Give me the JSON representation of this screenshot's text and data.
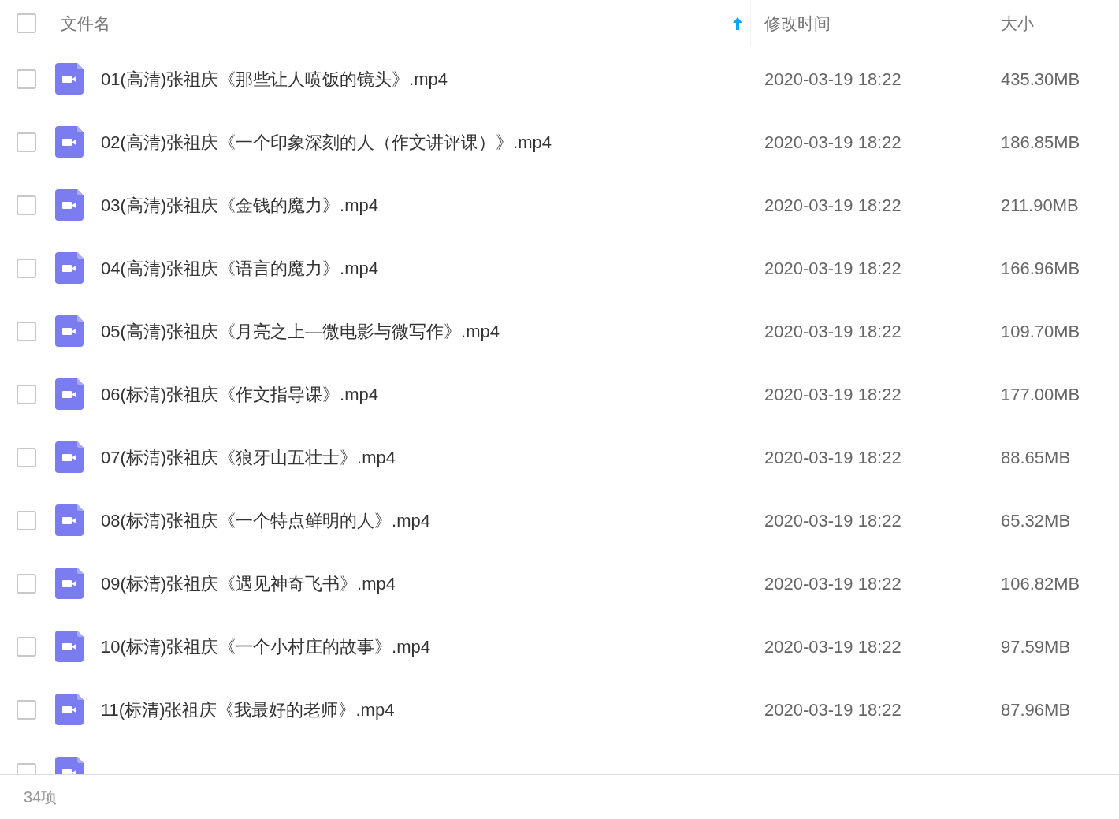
{
  "header": {
    "checked": false,
    "columns": [
      {
        "label": "文件名",
        "sorted": true
      },
      {
        "label": "修改时间",
        "sorted": false
      },
      {
        "label": "大小",
        "sorted": false
      }
    ]
  },
  "files": [
    {
      "checked": false,
      "name": "01(高清)张祖庆《那些让人喷饭的镜头》.mp4",
      "modified": "2020-03-19 18:22",
      "size": "435.30MB"
    },
    {
      "checked": false,
      "name": "02(高清)张祖庆《一个印象深刻的人（作文讲评课）》.mp4",
      "modified": "2020-03-19 18:22",
      "size": "186.85MB"
    },
    {
      "checked": false,
      "name": "03(高清)张祖庆《金钱的魔力》.mp4",
      "modified": "2020-03-19 18:22",
      "size": "211.90MB"
    },
    {
      "checked": false,
      "name": "04(高清)张祖庆《语言的魔力》.mp4",
      "modified": "2020-03-19 18:22",
      "size": "166.96MB"
    },
    {
      "checked": false,
      "name": "05(高清)张祖庆《月亮之上—微电影与微写作》.mp4",
      "modified": "2020-03-19 18:22",
      "size": "109.70MB"
    },
    {
      "checked": false,
      "name": "06(标清)张祖庆《作文指导课》.mp4",
      "modified": "2020-03-19 18:22",
      "size": "177.00MB"
    },
    {
      "checked": false,
      "name": "07(标清)张祖庆《狼牙山五壮士》.mp4",
      "modified": "2020-03-19 18:22",
      "size": "88.65MB"
    },
    {
      "checked": false,
      "name": "08(标清)张祖庆《一个特点鲜明的人》.mp4",
      "modified": "2020-03-19 18:22",
      "size": "65.32MB"
    },
    {
      "checked": false,
      "name": "09(标清)张祖庆《遇见神奇飞书》.mp4",
      "modified": "2020-03-19 18:22",
      "size": "106.82MB"
    },
    {
      "checked": false,
      "name": "10(标清)张祖庆《一个小村庄的故事》.mp4",
      "modified": "2020-03-19 18:22",
      "size": "97.59MB"
    },
    {
      "checked": false,
      "name": "11(标清)张祖庆《我最好的老师》.mp4",
      "modified": "2020-03-19 18:22",
      "size": "87.96MB"
    },
    {
      "checked": false
    }
  ],
  "footer": {
    "count": "34项"
  }
}
